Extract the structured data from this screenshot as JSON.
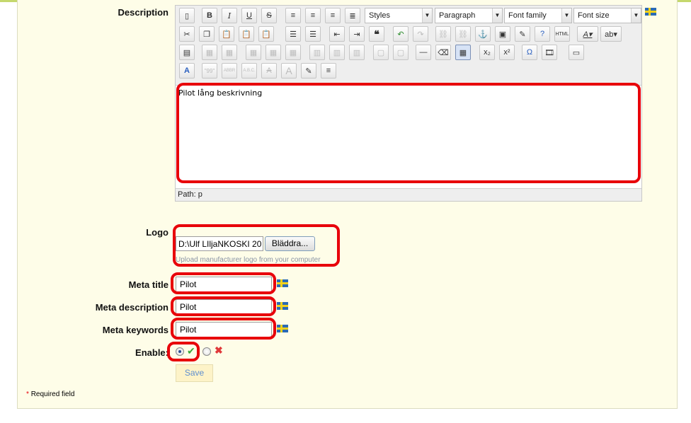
{
  "form": {
    "description_label": "Description",
    "logo_label": "Logo",
    "meta_title_label": "Meta title",
    "meta_description_label": "Meta description",
    "meta_keywords_label": "Meta keywords",
    "enable_label": "Enable:",
    "save_label": "Save",
    "required_note": "Required field",
    "required_star": "*"
  },
  "editor": {
    "styles_label": "Styles",
    "paragraph_label": "Paragraph",
    "font_family_label": "Font family",
    "font_size_label": "Font size",
    "content": "Pilot lång beskrivning",
    "path_label": "Path: p"
  },
  "toolbar_glyphs": {
    "bold": "B",
    "italic": "I",
    "underline": "U",
    "strike": "S",
    "quote": "❝",
    "omega": "Ω",
    "subscript": "x₂",
    "superscript": "x²"
  },
  "logo": {
    "file_value": "D:\\Ulf LIljaNKOSKI 20",
    "browse_label": "Bläddra...",
    "hint": "Upload manufacturer logo from your computer"
  },
  "meta": {
    "title_value": "Pilot",
    "description_value": "Pilot",
    "keywords_value": "Pilot"
  },
  "enable": {
    "yes_icon": "✔",
    "no_icon": "✖",
    "selected": "yes"
  },
  "colors": {
    "highlight": "#e8000a",
    "panel": "#fefde8",
    "save_text": "#5f8fcf"
  }
}
